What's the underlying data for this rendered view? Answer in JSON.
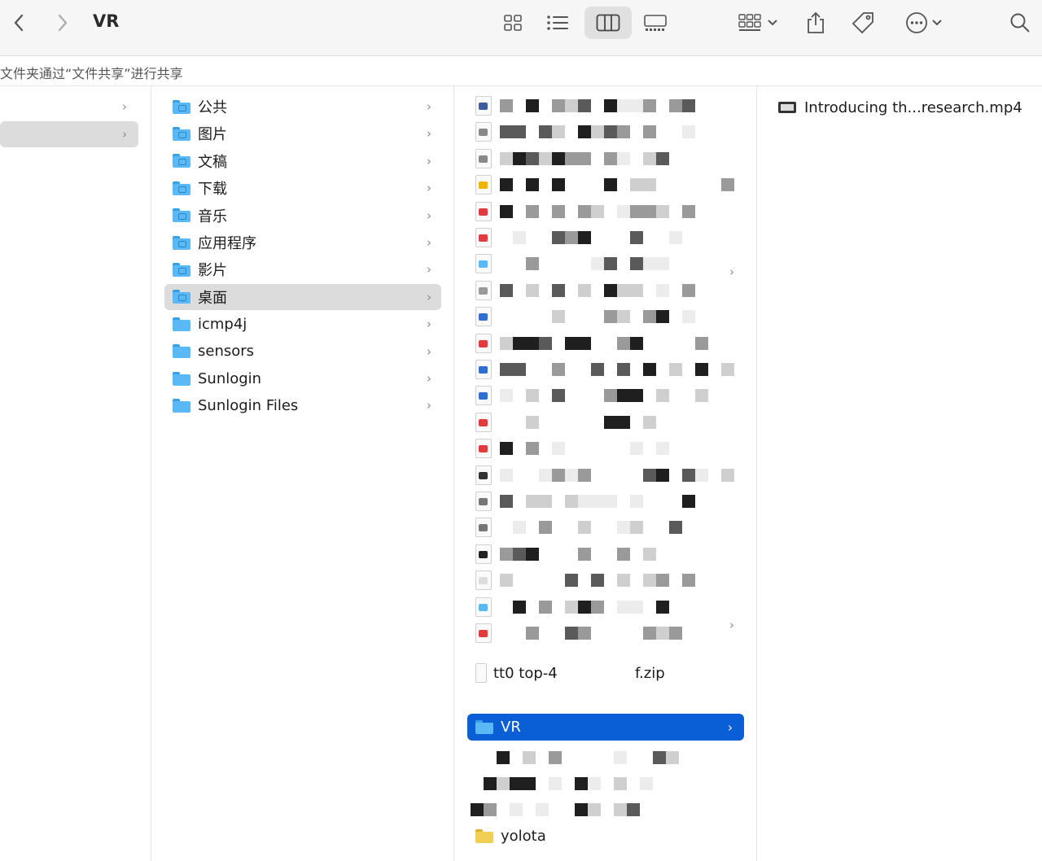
{
  "window": {
    "title": "VR"
  },
  "toolbar": {
    "back_icon": "chevron-left-icon",
    "forward_icon": "chevron-right-icon",
    "views": [
      "icon-view-icon",
      "list-view-icon",
      "column-view-icon",
      "gallery-view-icon"
    ],
    "active_view": "column-view-icon"
  },
  "infobar": {
    "text": "文件夹通过“文件共享”进行共享"
  },
  "column2": {
    "items": [
      {
        "label": "公共"
      },
      {
        "label": "图片"
      },
      {
        "label": "文稿"
      },
      {
        "label": "下载"
      },
      {
        "label": "音乐"
      },
      {
        "label": "应用程序"
      },
      {
        "label": "影片"
      },
      {
        "label": "桌面"
      },
      {
        "label": "icmp4j"
      },
      {
        "label": "sensors"
      },
      {
        "label": "Sunlogin"
      },
      {
        "label": "Sunlogin Files"
      }
    ],
    "selected": "桌面"
  },
  "column3": {
    "partial_label_1": "tt0 top-4",
    "partial_label_2": "f.zip",
    "selected_label": "VR",
    "partial_label_3": "yolota"
  },
  "column4": {
    "file_name": "Introducing th...research.mp4"
  },
  "colors": {
    "selection_blue": "#0a5fd6",
    "folder_blue": "#5ab8f4"
  }
}
